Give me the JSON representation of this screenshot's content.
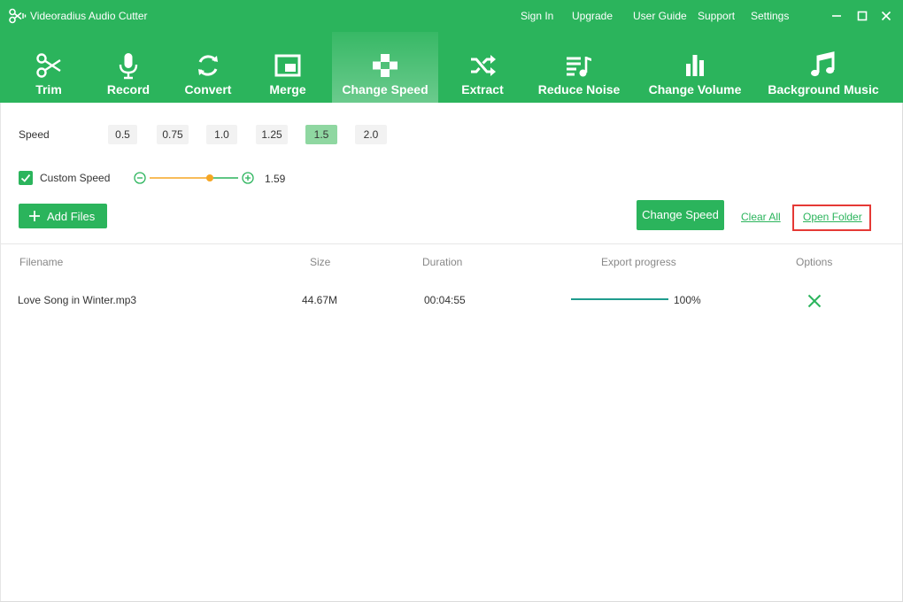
{
  "app": {
    "title": "Videoradius Audio Cutter",
    "accent_color": "#2bb45c"
  },
  "titlebar": {
    "links": [
      "Sign In",
      "Upgrade",
      "User Guide",
      "Support",
      "Settings"
    ],
    "window_icons": [
      "minimize-icon",
      "maximize-icon",
      "close-icon"
    ]
  },
  "toolbar": {
    "tools": [
      {
        "label": "Trim",
        "icon": "scissors-icon"
      },
      {
        "label": "Record",
        "icon": "microphone-icon"
      },
      {
        "label": "Convert",
        "icon": "refresh-icon"
      },
      {
        "label": "Merge",
        "icon": "merge-icon"
      },
      {
        "label": "Change Speed",
        "icon": "gamepad-icon"
      },
      {
        "label": "Extract",
        "icon": "shuffle-icon"
      },
      {
        "label": "Reduce Noise",
        "icon": "playlist-music-icon"
      },
      {
        "label": "Change Volume",
        "icon": "bar-chart-icon"
      },
      {
        "label": "Background Music",
        "icon": "music-note-icon"
      }
    ],
    "active": "Change Speed"
  },
  "speed": {
    "label": "Speed",
    "options": [
      "0.5",
      "0.75",
      "1.0",
      "1.25",
      "1.5",
      "2.0"
    ],
    "selected": "1.5",
    "selected_color": "#8fd7a1"
  },
  "custom_speed": {
    "label": "Custom Speed",
    "checked": true,
    "value": "1.59",
    "slider_fraction": 0.68,
    "slider_color": "#f5a623"
  },
  "actions": {
    "add_files": "Add Files",
    "change_speed": "Change Speed",
    "clear_all": "Clear All",
    "open_folder": "Open Folder",
    "highlight_color": "#e53935"
  },
  "table": {
    "columns": [
      "Filename",
      "Size",
      "Duration",
      "Export progress",
      "Options"
    ],
    "rows": [
      {
        "filename": "Love Song in Winter.mp3",
        "size": "44.67M",
        "duration": "00:04:55",
        "progress": "100%",
        "progress_fraction": 1.0,
        "option_icon": "close-x-icon"
      }
    ]
  }
}
